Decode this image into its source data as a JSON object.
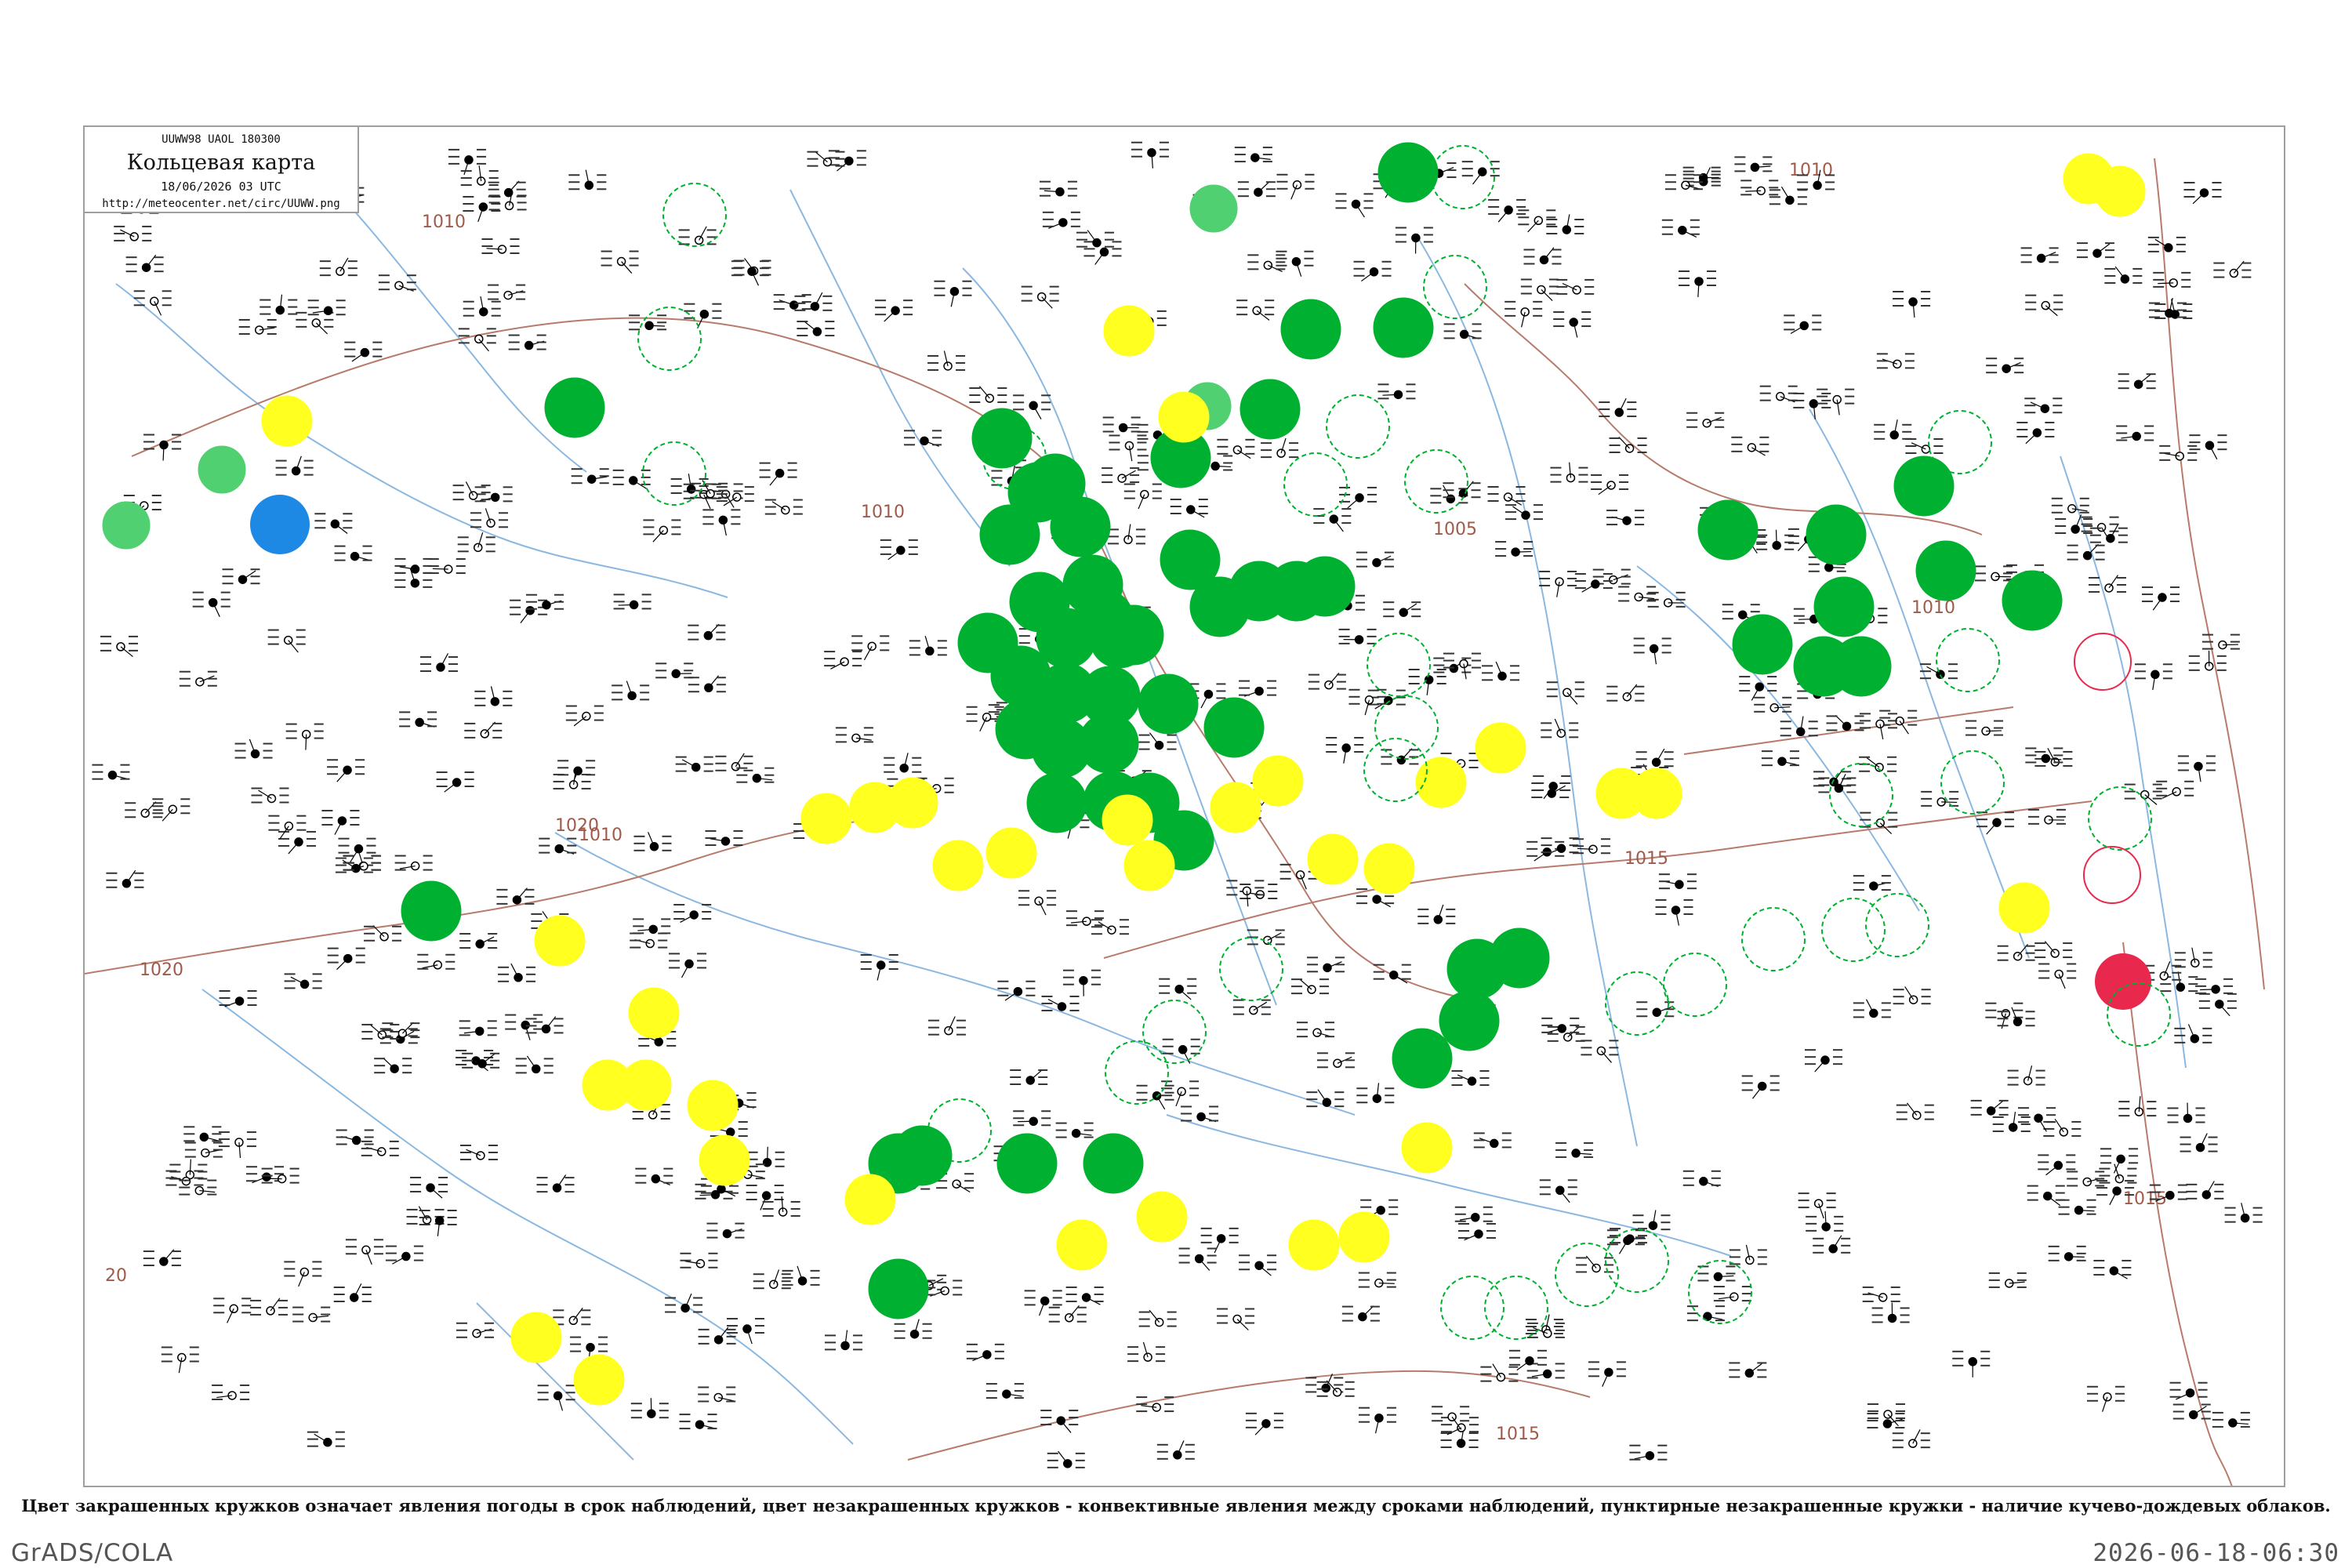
{
  "header": {
    "code": "UUWW98  UAOL  180300",
    "title": "Кольцевая карта",
    "date": "18/06/2026 03 UTC",
    "url": "http://meteocenter.net/circ/UUWW.png"
  },
  "caption": "Цвет закрашенных кружков означает явления погоды в срок наблюдений, цвет незакрашенных кружков - конвективные явления между сроками наблюдений, пунктирные незакрашенные кружки - наличие кучево-дождевых облаков.",
  "footer": {
    "left": "GrADS/COLA",
    "right": "2026-06-18-06:30"
  },
  "colors": {
    "rain": "#00b030",
    "rain_light": "#50d070",
    "drizzle": "#ffff20",
    "shower": "#1e88e5",
    "thunder": "#e8284c",
    "isobar": "#b87a6a",
    "river": "#8ab8e0",
    "frame": "#9e9e9e"
  },
  "isobar_labels": [
    "1010",
    "1010",
    "1010",
    "1005",
    "1015",
    "1015",
    "1020",
    "1020",
    "1015",
    "1010",
    "1010",
    "20"
  ],
  "stations": [
    {
      "icon": "filled-circle",
      "color": "rain"
    },
    {
      "icon": "filled-circle",
      "color": "drizzle"
    },
    {
      "icon": "filled-circle",
      "color": "shower"
    },
    {
      "icon": "filled-circle",
      "color": "thunder"
    },
    {
      "icon": "dashed-circle",
      "color": "rain"
    },
    {
      "icon": "open-circle",
      "color": "thunder"
    }
  ]
}
